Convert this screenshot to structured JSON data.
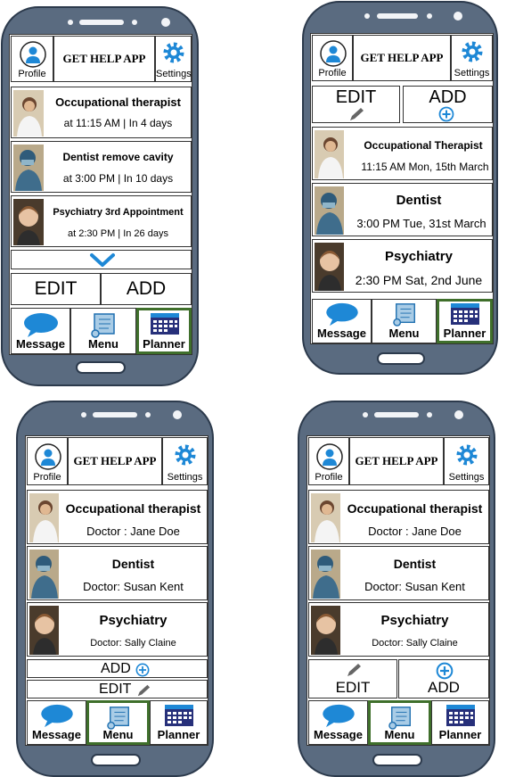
{
  "app": {
    "title": "GET HELP APP",
    "profile_label": "Profile",
    "settings_label": "Settings"
  },
  "nav": {
    "message": "Message",
    "menu": "Menu",
    "planner": "Planner"
  },
  "icons": [
    "profile-icon",
    "gear-icon",
    "chevron-down-icon",
    "speech-bubble-icon",
    "scroll-icon",
    "calendar-icon",
    "pencil-icon",
    "plus-circle-icon"
  ],
  "colors": {
    "accent": "#1e88d6",
    "phone_body": "#5a6b80",
    "active_nav": "#3f6f2b",
    "calendar": "#27307a"
  },
  "screen1": {
    "rows": [
      {
        "title": "Occupational therapist",
        "sub": "at 11:15 AM | In 4 days"
      },
      {
        "title": "Dentist remove cavity",
        "sub": "at 3:00 PM | In 10 days"
      },
      {
        "title": "Psychiatry 3rd Appointment",
        "sub": "at 2:30 PM | In 26 days"
      }
    ],
    "edit": "EDIT",
    "add": "ADD"
  },
  "screen2": {
    "edit": "EDIT",
    "add": "ADD",
    "rows": [
      {
        "title": "Occupational Therapist",
        "sub": "11:15 AM Mon, 15th March"
      },
      {
        "title": "Dentist",
        "sub": "3:00 PM Tue, 31st March"
      },
      {
        "title": "Psychiatry",
        "sub": "2:30 PM Sat, 2nd June"
      }
    ]
  },
  "screen3": {
    "rows": [
      {
        "title": "Occupational therapist",
        "sub": "Doctor : Jane Doe"
      },
      {
        "title": "Dentist",
        "sub": "Doctor: Susan Kent"
      },
      {
        "title": "Psychiatry",
        "sub": "Doctor: Sally Claine"
      }
    ],
    "add": "ADD",
    "edit": "EDIT"
  },
  "screen4": {
    "rows": [
      {
        "title": "Occupational therapist",
        "sub": "Doctor : Jane Doe"
      },
      {
        "title": "Dentist",
        "sub": "Doctor: Susan Kent"
      },
      {
        "title": "Psychiatry",
        "sub": "Doctor: Sally Claine"
      }
    ],
    "edit": "EDIT",
    "add": "ADD"
  }
}
